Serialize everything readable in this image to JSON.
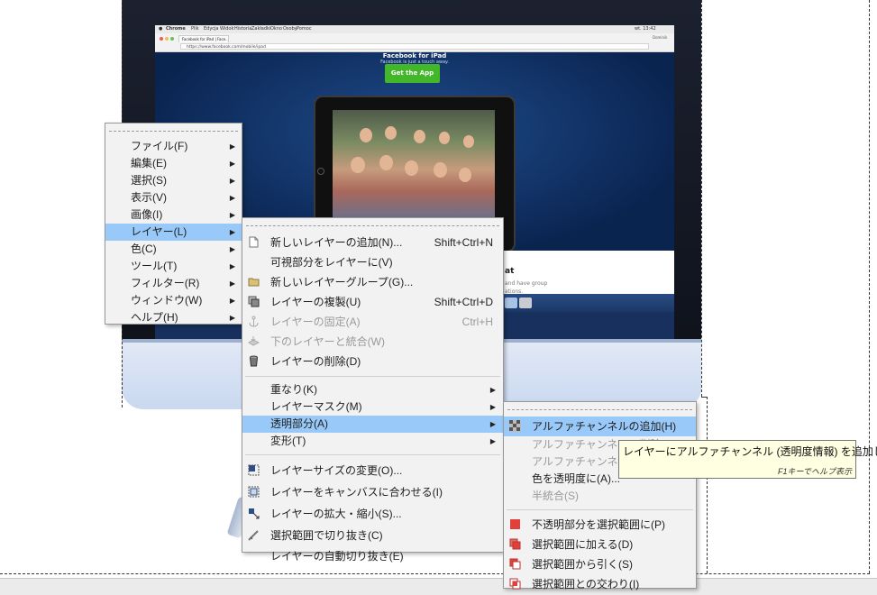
{
  "photo": {
    "mac_menubar": [
      "Chrome",
      "Plik",
      "Edycja",
      "Widok",
      "Historia",
      "Zakładki",
      "Okno",
      "Osoby",
      "Pomoc"
    ],
    "mac_clock": "wt. 13:42",
    "browser_tab": "Facebook for iPad | Face...",
    "browser_user": "Dominik",
    "address": "https://www.facebook.com/mobile/ipad",
    "fb_title": "Facebook for iPad",
    "fb_subtitle": "Facebook is just a touch away.",
    "fb_cta": "Get the App",
    "fb_partial_heading": "at",
    "fb_partial_line1": "and have group",
    "fb_partial_line2": "ations."
  },
  "main_menu": {
    "items": [
      {
        "label": "ファイル(F)",
        "highlight": false
      },
      {
        "label": "編集(E)",
        "highlight": false
      },
      {
        "label": "選択(S)",
        "highlight": false
      },
      {
        "label": "表示(V)",
        "highlight": false
      },
      {
        "label": "画像(I)",
        "highlight": false
      },
      {
        "label": "レイヤー(L)",
        "highlight": true
      },
      {
        "label": "色(C)",
        "highlight": false
      },
      {
        "label": "ツール(T)",
        "highlight": false
      },
      {
        "label": "フィルター(R)",
        "highlight": false
      },
      {
        "label": "ウィンドウ(W)",
        "highlight": false
      },
      {
        "label": "ヘルプ(H)",
        "highlight": false
      }
    ]
  },
  "layer_menu": {
    "group1": [
      {
        "label": "新しいレイヤーの追加(N)...",
        "shortcut": "Shift+Ctrl+N",
        "icon": "new-layer-icon",
        "disabled": false
      },
      {
        "label": "可視部分をレイヤーに(V)",
        "shortcut": "",
        "icon": "",
        "disabled": false
      },
      {
        "label": "新しいレイヤーグループ(G)...",
        "shortcut": "",
        "icon": "folder-icon",
        "disabled": false
      },
      {
        "label": "レイヤーの複製(U)",
        "shortcut": "Shift+Ctrl+D",
        "icon": "duplicate-icon",
        "disabled": false
      },
      {
        "label": "レイヤーの固定(A)",
        "shortcut": "Ctrl+H",
        "icon": "anchor-icon",
        "disabled": true
      },
      {
        "label": "下のレイヤーと統合(W)",
        "shortcut": "",
        "icon": "merge-icon",
        "disabled": true
      },
      {
        "label": "レイヤーの削除(D)",
        "shortcut": "",
        "icon": "trash-icon",
        "disabled": false
      }
    ],
    "group2": [
      {
        "label": "重なり(K)",
        "highlight": false
      },
      {
        "label": "レイヤーマスク(M)",
        "highlight": false
      },
      {
        "label": "透明部分(A)",
        "highlight": true
      },
      {
        "label": "変形(T)",
        "highlight": false
      }
    ],
    "group3": [
      {
        "label": "レイヤーサイズの変更(O)...",
        "icon": "resize-icon"
      },
      {
        "label": "レイヤーをキャンバスに合わせる(I)",
        "icon": "fit-canvas-icon"
      },
      {
        "label": "レイヤーの拡大・縮小(S)...",
        "icon": "scale-icon"
      },
      {
        "label": "選択範囲で切り抜き(C)",
        "icon": "crop-icon"
      },
      {
        "label": "レイヤーの自動切り抜き(E)",
        "icon": ""
      }
    ]
  },
  "transparency_menu": {
    "group1": [
      {
        "label": "アルファチャンネルの追加(H)",
        "icon": "alpha-checker-icon",
        "disabled": false,
        "highlight": true
      },
      {
        "label": "アルファチャンネルの削除(R)",
        "icon": "",
        "disabled": true,
        "highlight": false
      },
      {
        "label": "アルファチャンネルしきい値(T)...",
        "icon": "",
        "disabled": true,
        "highlight": false
      },
      {
        "label": "色を透明度に(A)...",
        "icon": "",
        "disabled": false,
        "highlight": false
      },
      {
        "label": "半統合(S)",
        "icon": "",
        "disabled": true,
        "highlight": false
      }
    ],
    "group2": [
      {
        "label": "不透明部分を選択範囲に(P)",
        "icon": "selection-replace-icon"
      },
      {
        "label": "選択範囲に加える(D)",
        "icon": "selection-add-icon"
      },
      {
        "label": "選択範囲から引く(S)",
        "icon": "selection-subtract-icon"
      },
      {
        "label": "選択範囲との交わり(I)",
        "icon": "selection-intersect-icon"
      }
    ]
  },
  "tooltip": {
    "text": "レイヤーにアルファチャンネル (透明度情報) を追加します",
    "help": "F1キーでヘルプ表示"
  },
  "colors": {
    "menu_bg": "#f2f2f2",
    "highlight": "#99c9f8",
    "disabled_text": "#9a9a9a",
    "tooltip_bg": "#ffffe1"
  }
}
